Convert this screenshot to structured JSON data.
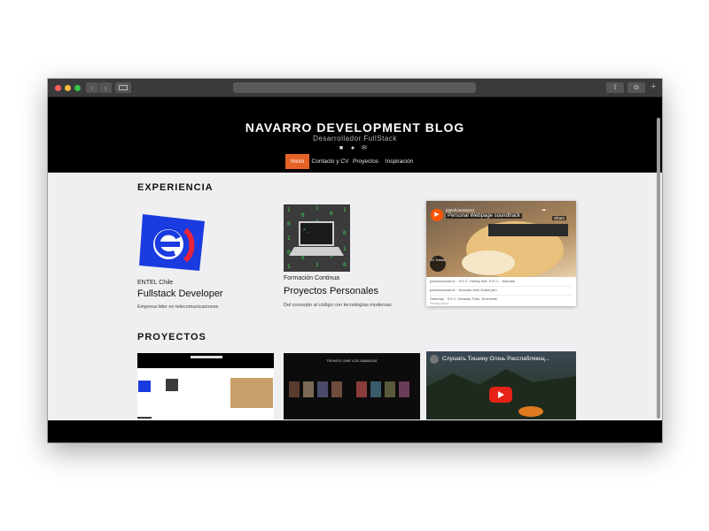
{
  "browser": {
    "back_icon": "chevron-left-icon",
    "forward_icon": "chevron-right-icon",
    "address": ""
  },
  "site": {
    "title": "NAVARRO DEVELOPMENT BLOG",
    "subtitle": "Desarrollador FullStack",
    "social_icons": [
      "linkedin-icon",
      "github-icon",
      "email-icon"
    ],
    "nav": [
      "Inicio",
      "Contacto y CV",
      "Proyectos",
      "Inspiración"
    ],
    "active_nav": "Inicio",
    "accent_color": "#e46224"
  },
  "experience": {
    "heading": "EXPERIENCIA",
    "cards": [
      {
        "meta": "ENTEL Chile",
        "title": "Fullstack Developer",
        "desc": "Empresa lider en telecomunicaciones"
      },
      {
        "meta": "Formación Continua",
        "title": "Proyectos Personales",
        "desc": "Del concepto al código con tecnologías modernas"
      }
    ],
    "player": {
      "channel": "panchonavarro1",
      "track": "Personal Webpage soundtrack",
      "tracks_label": "20 Tracks",
      "share_label": "Share",
      "rows": [
        "panchonavarro1 · S.E.C. Hubby feat. S.E.C. · Animais",
        "panchonavarro1 · Acoustic funk Guitar jam",
        "Saturday · S.E.C. Animais Tribe, Emimesis"
      ],
      "footer": "Privacy policy"
    }
  },
  "projects": {
    "heading": "PROYECTOS",
    "thumb2_title": "TRONTO CINE LOS SABADOS",
    "video_title": "Слушать Тишину Огонь Расслабляющ..."
  }
}
